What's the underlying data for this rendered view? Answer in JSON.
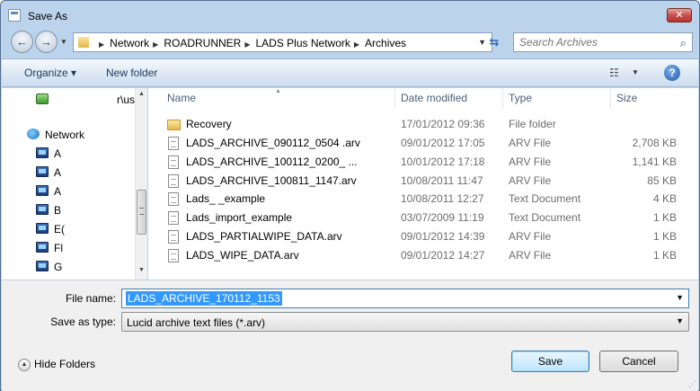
{
  "window": {
    "title": "Save As",
    "close_label": "✕"
  },
  "address": {
    "breadcrumbs": [
      "Network",
      "ROADRUNNER",
      "LADS Plus Network",
      "Archives"
    ],
    "search_placeholder": "Search Archives"
  },
  "toolbar": {
    "organize_label": "Organize ▾",
    "new_folder_label": "New folder"
  },
  "nav": {
    "top_item_label": "r\\us",
    "network_label": "Network",
    "computers": [
      "A",
      "A",
      "A",
      "B",
      "E(",
      "Fl",
      "G"
    ]
  },
  "columns": {
    "name": "Name",
    "date": "Date modified",
    "type": "Type",
    "size": "Size"
  },
  "files": [
    {
      "name": "Recovery",
      "date": "17/01/2012 09:36",
      "type": "File folder",
      "size": "",
      "icon": "folder-icon"
    },
    {
      "name": "LADS_ARCHIVE_090112_0504        .arv",
      "date": "09/01/2012 17:05",
      "type": "ARV File",
      "size": "2,708 KB",
      "icon": "file-icon"
    },
    {
      "name": "LADS_ARCHIVE_100112_0200_             ...",
      "date": "10/01/2012 17:18",
      "type": "ARV File",
      "size": "1,141 KB",
      "icon": "file-icon"
    },
    {
      "name": "LADS_ARCHIVE_100811_1147.arv",
      "date": "10/08/2011 11:47",
      "type": "ARV File",
      "size": "85 KB",
      "icon": "file-icon"
    },
    {
      "name": "Lads_                   _example",
      "date": "10/08/2011 12:27",
      "type": "Text Document",
      "size": "4 KB",
      "icon": "text-file-icon"
    },
    {
      "name": "Lads_import_example",
      "date": "03/07/2009 11:19",
      "type": "Text Document",
      "size": "1 KB",
      "icon": "text-file-icon"
    },
    {
      "name": "LADS_PARTIALWIPE_DATA.arv",
      "date": "09/01/2012 14:39",
      "type": "ARV File",
      "size": "1 KB",
      "icon": "file-icon"
    },
    {
      "name": "LADS_WIPE_DATA.arv",
      "date": "09/01/2012 14:27",
      "type": "ARV File",
      "size": "1 KB",
      "icon": "file-icon"
    }
  ],
  "form": {
    "file_name_label": "File name:",
    "file_name_value": "LADS_ARCHIVE_170112_1153",
    "save_as_type_label": "Save as type:",
    "save_as_type_value": "Lucid archive text files (*.arv)",
    "hide_folders_label": "Hide Folders",
    "save_label": "Save",
    "cancel_label": "Cancel"
  }
}
